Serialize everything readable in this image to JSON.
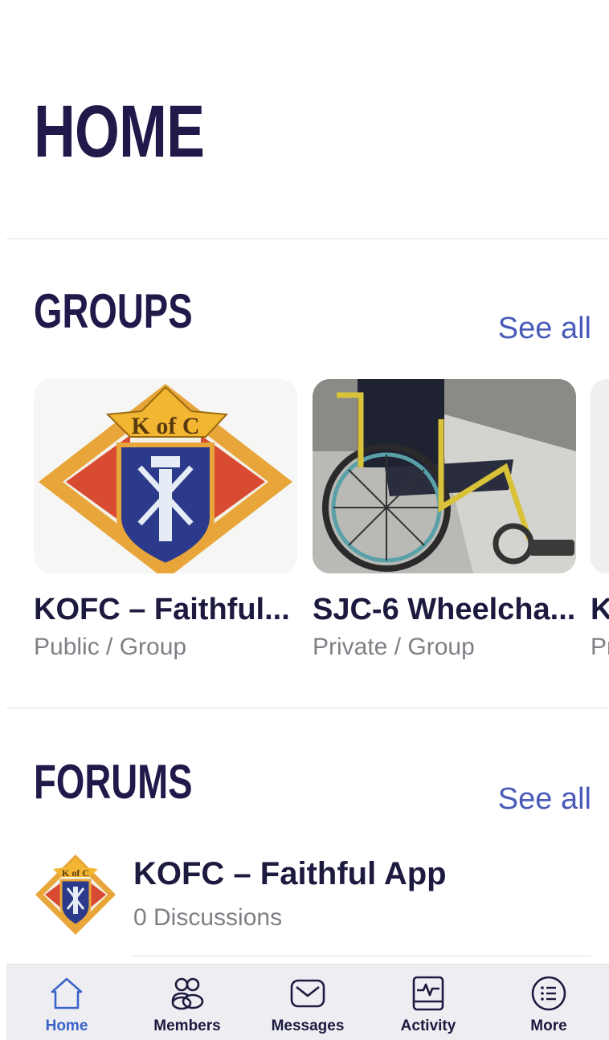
{
  "header": {
    "title": "HOME"
  },
  "groups": {
    "title": "GROUPS",
    "see_all": "See all",
    "items": [
      {
        "name": "KOFC – Faithful...",
        "meta": "Public / Group"
      },
      {
        "name": "SJC-6 Wheelcha...",
        "meta": "Private / Group"
      },
      {
        "name": "K",
        "meta": "Pr"
      }
    ]
  },
  "forums": {
    "title": "FORUMS",
    "see_all": "See all",
    "items": [
      {
        "title": "KOFC – Faithful App",
        "subtitle": "0 Discussions"
      }
    ]
  },
  "tabbar": {
    "items": [
      {
        "label": "Home",
        "icon": "home-icon",
        "active": true
      },
      {
        "label": "Members",
        "icon": "members-icon",
        "active": false
      },
      {
        "label": "Messages",
        "icon": "envelope-icon",
        "active": false
      },
      {
        "label": "Activity",
        "icon": "activity-icon",
        "active": false
      },
      {
        "label": "More",
        "icon": "list-icon",
        "active": false
      }
    ]
  },
  "colors": {
    "title": "#1f1a4a",
    "accent": "#4a5bb8",
    "active_tab": "#3a63c9",
    "muted": "#7f7f86"
  }
}
